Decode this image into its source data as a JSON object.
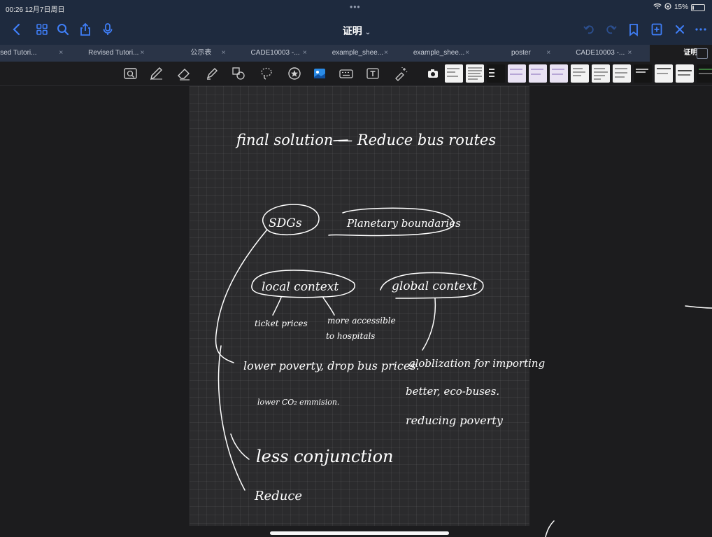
{
  "status_bar": {
    "time": "00:26  12月7日周日",
    "battery": "15%",
    "battery_level": 0.15
  },
  "nav_bar": {
    "title": "证明",
    "icons": [
      "back-icon",
      "grid-icon",
      "search-icon",
      "share-icon",
      "microphone-icon",
      "undo-icon",
      "redo-icon",
      "bookmark-icon",
      "add-page-icon",
      "close-icon",
      "more-icon"
    ]
  },
  "tabs": [
    {
      "label": "ised Tutori...",
      "close": "×"
    },
    {
      "label": "Revised Tutori...",
      "close": "×"
    },
    {
      "label": "公示表",
      "close": "×"
    },
    {
      "label": "CADE10003 -...",
      "close": "×"
    },
    {
      "label": "example_shee...",
      "close": "×"
    },
    {
      "label": "example_shee...",
      "close": "×"
    },
    {
      "label": "poster",
      "close": "×"
    },
    {
      "label": "CADE10003 -...",
      "close": "×"
    },
    {
      "label": "证明",
      "active": true
    }
  ],
  "toolbar": {
    "tools": [
      "lasso-zoom-icon",
      "pen-icon",
      "eraser-icon",
      "highlighter-icon",
      "shapes-icon",
      "lasso-icon",
      "sticker-icon",
      "image-icon",
      "keyboard-icon",
      "text-box-icon",
      "laser-pointer-icon"
    ]
  },
  "notes": {
    "title": "final solution — Reduce bus routes",
    "sdgs": "SDGs",
    "planetary": "Planetary boundaries",
    "local_context": "local context",
    "global_context": "global context",
    "ticket_prices": "ticket prices",
    "more_accessible_1": "more accessible",
    "more_accessible_2": "to hospitals",
    "lower_poverty": "lower poverty, drop bus prices.",
    "lower_co2": "lower CO₂ emmision.",
    "globalization_1": "globlization for importing",
    "globalization_2": "better, eco-buses.",
    "reducing_poverty": "reducing poverty",
    "less_congestion": "less conjunction",
    "reduce": "Reduce"
  }
}
